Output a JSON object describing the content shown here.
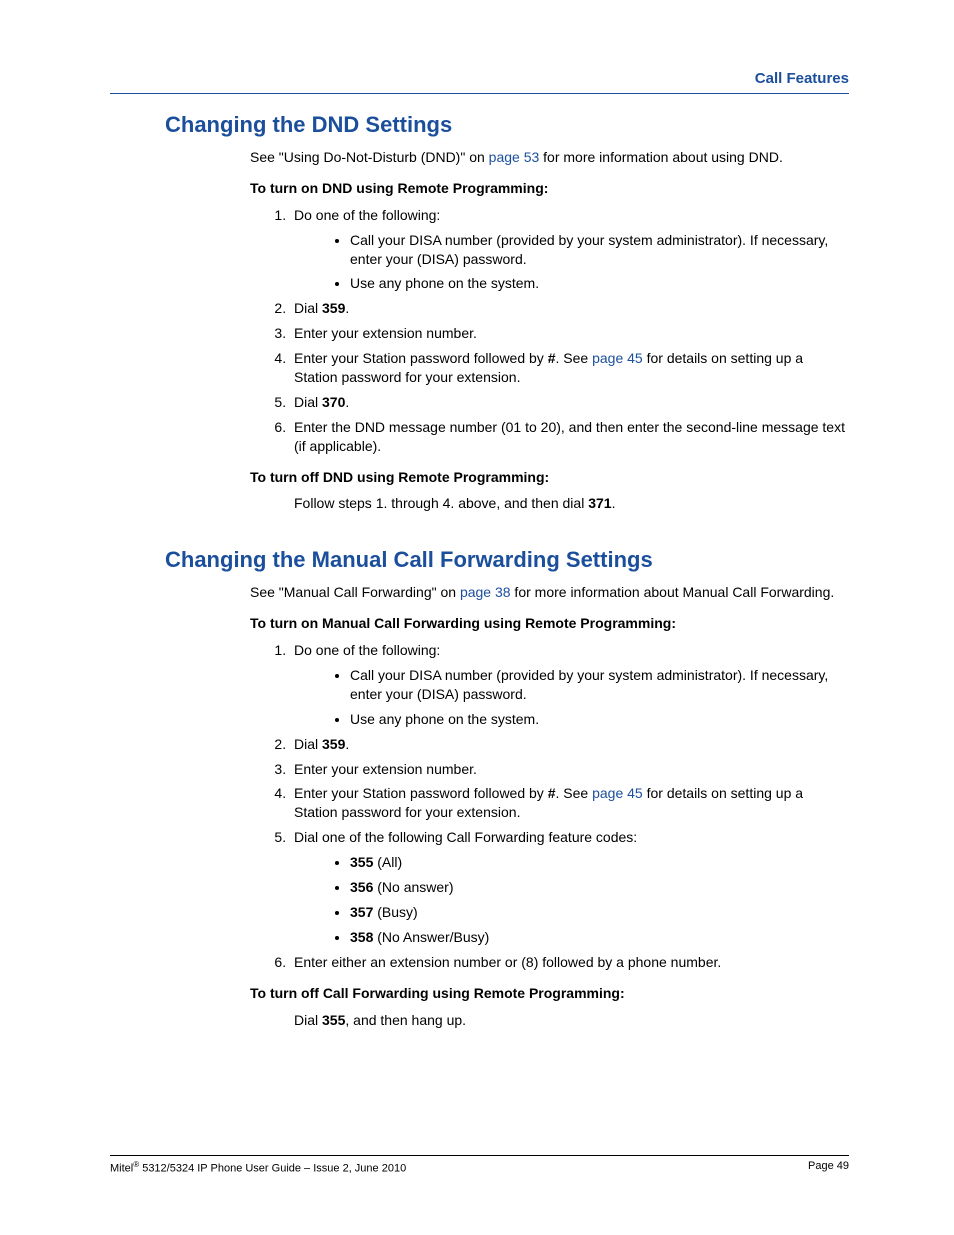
{
  "header": {
    "category": "Call Features"
  },
  "section1": {
    "title": "Changing the DND Settings",
    "intro_pre": "See \"Using Do-Not-Disturb (DND)\" on ",
    "intro_link": "page 53",
    "intro_post": " for more information about using DND.",
    "sub_on": "To turn on DND using Remote Programming:",
    "step1": "Do one of the following:",
    "step1_b1": "Call your DISA number (provided by your system administrator). If necessary, enter your (DISA) password.",
    "step1_b2": "Use any phone on the system.",
    "step2_a": "Dial ",
    "step2_b": "359",
    "step2_c": ".",
    "step3": "Enter your extension number.",
    "step4_a": "Enter your Station password followed by ",
    "step4_b": "#",
    "step4_c": ". See ",
    "step4_link": "page 45",
    "step4_d": " for details on setting up a Station password for your extension.",
    "step5_a": "Dial ",
    "step5_b": "370",
    "step5_c": ".",
    "step6": "Enter the DND message number (01 to 20), and then enter the second-line message text (if applicable).",
    "sub_off": "To turn off DND using Remote Programming:",
    "off_text_a": "Follow steps 1. through 4. above, and then dial ",
    "off_text_b": "371",
    "off_text_c": "."
  },
  "section2": {
    "title": "Changing the Manual Call Forwarding Settings",
    "intro_pre": "See \"Manual Call Forwarding\" on ",
    "intro_link": "page 38",
    "intro_post": " for more information about Manual Call Forwarding.",
    "sub_on": "To turn on Manual Call Forwarding using Remote Programming:",
    "step1": "Do one of the following:",
    "step1_b1": "Call your DISA number (provided by your system administrator). If necessary, enter your (DISA) password.",
    "step1_b2": "Use any phone on the system.",
    "step2_a": "Dial ",
    "step2_b": "359",
    "step2_c": ".",
    "step3": "Enter your extension number.",
    "step4_a": "Enter your Station password followed by ",
    "step4_b": "#",
    "step4_c": ". See ",
    "step4_link": "page 45",
    "step4_d": " for details on setting up a Station password for your extension.",
    "step5": "Dial one of the following Call Forwarding feature codes:",
    "codes": {
      "c1b": "355",
      "c1t": " (All)",
      "c2b": "356",
      "c2t": " (No answer)",
      "c3b": "357",
      "c3t": " (Busy)",
      "c4b": "358",
      "c4t": " (No Answer/Busy)"
    },
    "step6": "Enter either an extension number or (8) followed by a phone number.",
    "sub_off": "To turn off Call Forwarding using Remote Programming:",
    "off_text_a": "Dial ",
    "off_text_b": "355",
    "off_text_c": ", and then hang up."
  },
  "footer": {
    "left_a": "Mitel",
    "left_b": " 5312/5324 IP Phone User Guide  – Issue 2, June 2010",
    "right": "Page 49"
  }
}
